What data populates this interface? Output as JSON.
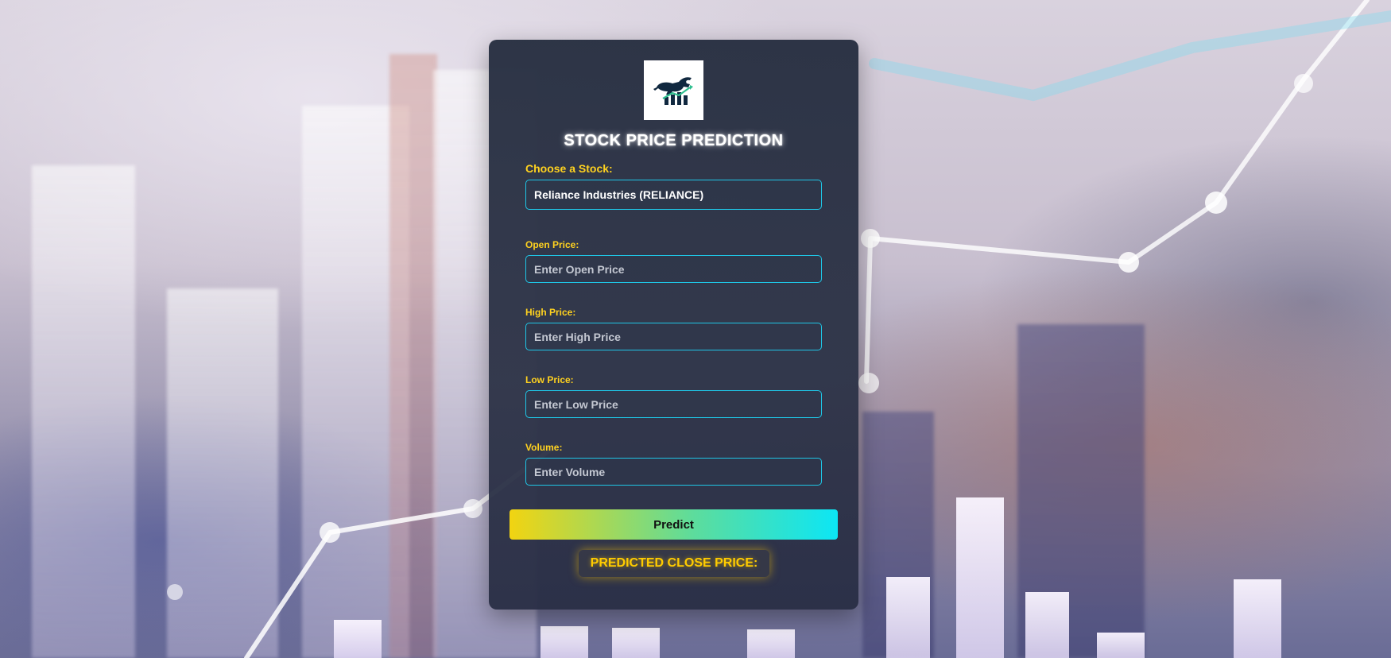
{
  "app": {
    "title": "STOCK PRICE PREDICTION"
  },
  "logo": {
    "icon": "bull-chart-logo-icon"
  },
  "stock_select": {
    "label": "Choose a Stock:",
    "value": "Reliance Industries (RELIANCE)"
  },
  "fields": {
    "open": {
      "label": "Open Price:",
      "placeholder": "Enter Open Price"
    },
    "high": {
      "label": "High Price:",
      "placeholder": "Enter High Price"
    },
    "low": {
      "label": "Low Price:",
      "placeholder": "Enter Low Price"
    },
    "volume": {
      "label": "Volume:",
      "placeholder": "Enter Volume"
    }
  },
  "predict_button": {
    "label": "Predict"
  },
  "result": {
    "label": "PREDICTED CLOSE PRICE:"
  },
  "colors": {
    "accent_label": "#ffd21f",
    "input_border": "#1fc6e6",
    "button_gradient_start": "#f2d411",
    "button_gradient_end": "#0ce6f5",
    "result_text": "#ffcc00"
  }
}
